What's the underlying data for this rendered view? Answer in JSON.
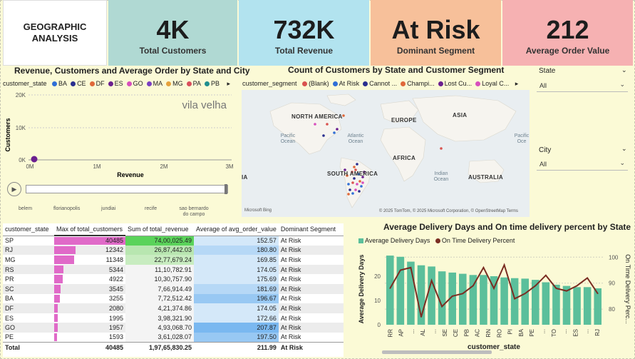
{
  "header": {
    "title": "GEOGRAPHIC ANALYSIS"
  },
  "kpis": [
    {
      "value": "4K",
      "label": "Total Customers",
      "color": "#b0d9d3"
    },
    {
      "value": "732K",
      "label": "Total Revenue",
      "color": "#b2e3ef"
    },
    {
      "value": "At Risk",
      "label": "Dominant Segment",
      "color": "#f7c09a"
    },
    {
      "value": "212",
      "label": "Average Order Value",
      "color": "#f6b1b2"
    }
  ],
  "scatter": {
    "title": "Revenue, Customers and Average Order by State and City",
    "legend_title": "customer_state",
    "legend": [
      {
        "name": "BA",
        "color": "#2f6fd6"
      },
      {
        "name": "CE",
        "color": "#2a2f8f"
      },
      {
        "name": "DF",
        "color": "#e0683a"
      },
      {
        "name": "ES",
        "color": "#6b1f8f"
      },
      {
        "name": "GO",
        "color": "#d84fbd"
      },
      {
        "name": "MA",
        "color": "#7a3fc2"
      },
      {
        "name": "MG",
        "color": "#e6a23c"
      },
      {
        "name": "PA",
        "color": "#d94f5c"
      },
      {
        "name": "PB",
        "color": "#1f8f8f"
      }
    ],
    "ylabel": "Customers",
    "xlabel": "Revenue",
    "yticks": [
      "20K",
      "10K",
      "0K"
    ],
    "xticks": [
      "0M",
      "1M",
      "2M",
      "3M"
    ],
    "play_label": "vila velha",
    "play_axis": [
      "belem",
      "florianopolis",
      "jundiai",
      "recife",
      "sao bernardo do campo"
    ]
  },
  "map": {
    "title": "Count of Customers by State and Customer Segment",
    "legend_title": "customer_segment",
    "legend": [
      {
        "name": "(Blank)",
        "color": "#d9534f"
      },
      {
        "name": "At Risk",
        "color": "#2f6fd6"
      },
      {
        "name": "Cannot ...",
        "color": "#2a2f8f"
      },
      {
        "name": "Champi...",
        "color": "#e0683a"
      },
      {
        "name": "Lost Cu...",
        "color": "#6b1f8f"
      },
      {
        "name": "Loyal C...",
        "color": "#d84fbd"
      }
    ],
    "labels": {
      "north_america": "NORTH AMERICA",
      "europe": "EUROPE",
      "asia": "ASIA",
      "africa": "AFRICA",
      "south_america": "SOUTH AMERICA",
      "australia": "AUSTRALIA",
      "pacific": "Pacific Ocean",
      "atlantic": "Atlantic Ocean",
      "indian": "Indian Ocean",
      "pacific_right": "Pacific Oce",
      "edge": "IA"
    },
    "attribution": "© 2025 TomTom, © 2025 Microsoft Corporation, © OpenStreetMap  Terms",
    "bing": "Microsoft Bing"
  },
  "slicers": [
    {
      "label": "State",
      "value": "All"
    },
    {
      "label": "City",
      "value": "All"
    }
  ],
  "table": {
    "columns": [
      "customer_state",
      "Max of total_customers",
      "Sum of total_revenue",
      "Average of avg_order_value",
      "Dominant Segment"
    ],
    "rows": [
      {
        "state": "SP",
        "customers": "40485",
        "revenue": "74,00,025.49",
        "aov": "152.57",
        "segment": "At Risk"
      },
      {
        "state": "RJ",
        "customers": "12342",
        "revenue": "26,87,442.03",
        "aov": "180.80",
        "segment": "At Risk"
      },
      {
        "state": "MG",
        "customers": "11348",
        "revenue": "22,77,679.24",
        "aov": "169.85",
        "segment": "At Risk"
      },
      {
        "state": "RS",
        "customers": "5344",
        "revenue": "11,10,782.91",
        "aov": "174.05",
        "segment": "At Risk"
      },
      {
        "state": "PR",
        "customers": "4922",
        "revenue": "10,30,757.90",
        "aov": "175.69",
        "segment": "At Risk"
      },
      {
        "state": "SC",
        "customers": "3545",
        "revenue": "7,66,914.49",
        "aov": "181.69",
        "segment": "At Risk"
      },
      {
        "state": "BA",
        "customers": "3255",
        "revenue": "7,72,512.42",
        "aov": "196.67",
        "segment": "At Risk"
      },
      {
        "state": "DF",
        "customers": "2080",
        "revenue": "4,21,374.86",
        "aov": "174.05",
        "segment": "At Risk"
      },
      {
        "state": "ES",
        "customers": "1995",
        "revenue": "3,98,321.90",
        "aov": "172.66",
        "segment": "At Risk"
      },
      {
        "state": "GO",
        "customers": "1957",
        "revenue": "4,93,068.70",
        "aov": "207.87",
        "segment": "At Risk"
      },
      {
        "state": "PE",
        "customers": "1593",
        "revenue": "3,61,028.07",
        "aov": "197.50",
        "segment": "At Risk"
      }
    ],
    "total": {
      "label": "Total",
      "customers": "40485",
      "revenue": "1,97,65,830.25",
      "aov": "211.99",
      "segment": "At Risk"
    }
  },
  "chart_data": {
    "type": "bar",
    "title": "Average Delivery Days and On time delivery percent by State",
    "xlabel": "customer_state",
    "ylabel": "Average Delivery Days",
    "y2label": "On Time Delivery Perc...",
    "series": [
      {
        "name": "Average Delivery Days",
        "color": "#5bbf9b",
        "values": [
          28.5,
          28,
          26,
          24.5,
          24,
          22,
          21.5,
          21,
          20.5,
          20.5,
          20,
          19.5,
          19.2,
          19,
          18.5,
          17.5,
          16.5,
          16,
          15.5,
          15.5,
          15
        ]
      },
      {
        "name": "On Time Delivery Percent",
        "color": "#7a2d22",
        "values": [
          88,
          95,
          96,
          77,
          91,
          81,
          85,
          86,
          89,
          96,
          88,
          97,
          84,
          86,
          89,
          93,
          88,
          87,
          89,
          92,
          86
        ]
      }
    ],
    "categories": [
      "RR",
      "AP",
      "",
      "AL",
      "",
      "",
      "SE",
      "CE",
      "PB",
      "AC",
      "RN",
      "RO",
      "PI",
      "BA",
      "PE",
      "",
      "TO",
      "",
      "ES",
      "",
      "RJ"
    ],
    "x_tick_labels": [
      "RR",
      "AP",
      "...",
      "AL",
      "...",
      "SE",
      "CE",
      "PB",
      "AC",
      "RN",
      "RO",
      "PI",
      "BA",
      "PE",
      "...",
      "TO",
      "...",
      "ES",
      "...",
      "RJ"
    ],
    "yticks": [
      "20",
      "10",
      "0"
    ],
    "y2ticks": [
      "100",
      "90",
      "80"
    ],
    "ylim": [
      0,
      30
    ],
    "y2lim": [
      74,
      102
    ]
  }
}
